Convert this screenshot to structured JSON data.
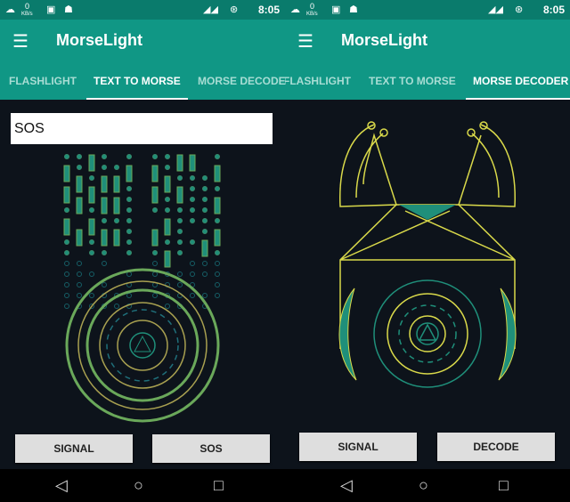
{
  "status": {
    "time": "8:05",
    "speed": "0",
    "speed_unit": "KB/s"
  },
  "app": {
    "title": "MorseLight"
  },
  "tabs": [
    "FLASHLIGHT",
    "TEXT TO MORSE",
    "MORSE DECODER"
  ],
  "left": {
    "active_tab": "TEXT TO MORSE",
    "input_value": "SOS",
    "buttons": [
      "SIGNAL",
      "SOS"
    ]
  },
  "right": {
    "active_tab": "MORSE DECODER",
    "buttons": [
      "SIGNAL",
      "DECODE"
    ]
  },
  "colors": {
    "status_bar": "#0a7b6c",
    "app_bar": "#109785",
    "background": "#0d131b",
    "accent_teal": "#1f8f7a",
    "accent_yellow": "#d9d94a",
    "morse_green": "#6aa85a"
  },
  "icons": {
    "menu": "hamburger-icon",
    "nav": [
      "back-icon",
      "home-icon",
      "recents-icon"
    ]
  }
}
